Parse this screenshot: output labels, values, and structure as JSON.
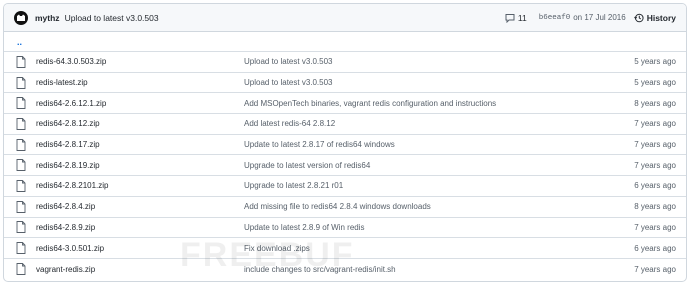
{
  "commit": {
    "author": "mythz",
    "message": "Upload to latest v3.0.503",
    "comment_count": "11",
    "sha": "b6eeaf0",
    "date_text": "on 17 Jul 2016",
    "history_label": "History"
  },
  "updir_label": "..",
  "files": [
    {
      "name": "redis-64.3.0.503.zip",
      "message": "Upload to latest v3.0.503",
      "age": "5 years ago"
    },
    {
      "name": "redis-latest.zip",
      "message": "Upload to latest v3.0.503",
      "age": "5 years ago"
    },
    {
      "name": "redis64-2.6.12.1.zip",
      "message": "Add MSOpenTech binaries, vagrant redis configuration and instructions",
      "age": "8 years ago"
    },
    {
      "name": "redis64-2.8.12.zip",
      "message": "Add latest redis-64 2.8.12",
      "age": "7 years ago"
    },
    {
      "name": "redis64-2.8.17.zip",
      "message": "Update to latest 2.8.17 of redis64 windows",
      "age": "7 years ago"
    },
    {
      "name": "redis64-2.8.19.zip",
      "message": "Upgrade to latest version of redis64",
      "age": "7 years ago"
    },
    {
      "name": "redis64-2.8.2101.zip",
      "message": "Upgrade to latest 2.8.21 r01",
      "age": "6 years ago"
    },
    {
      "name": "redis64-2.8.4.zip",
      "message": "Add missing file to redis64 2.8.4 windows downloads",
      "age": "8 years ago"
    },
    {
      "name": "redis64-2.8.9.zip",
      "message": "Update to latest 2.8.9 of Win redis",
      "age": "7 years ago"
    },
    {
      "name": "redis64-3.0.501.zip",
      "message": "Fix download .zips",
      "age": "6 years ago"
    },
    {
      "name": "vagrant-redis.zip",
      "message": "include changes to src/vagrant-redis/init.sh",
      "age": "7 years ago"
    }
  ],
  "watermark": "FREEBUF"
}
